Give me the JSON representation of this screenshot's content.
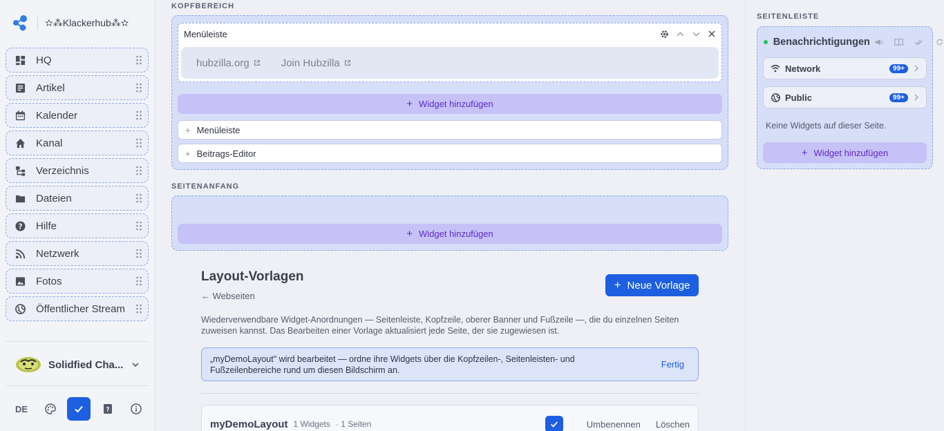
{
  "brand": {
    "name": "✫⁂Klackerhub⁂✫"
  },
  "nav": {
    "items": [
      {
        "label": "HQ",
        "icon": "hq-icon"
      },
      {
        "label": "Artikel",
        "icon": "article-icon"
      },
      {
        "label": "Kalender",
        "icon": "calendar-icon"
      },
      {
        "label": "Kanal",
        "icon": "home-icon"
      },
      {
        "label": "Verzeichnis",
        "icon": "directory-icon"
      },
      {
        "label": "Dateien",
        "icon": "folder-icon"
      },
      {
        "label": "Hilfe",
        "icon": "help-icon"
      },
      {
        "label": "Netzwerk",
        "icon": "rss-icon"
      },
      {
        "label": "Fotos",
        "icon": "photo-icon"
      },
      {
        "label": "Öffentlicher Stream",
        "icon": "globe-icon"
      }
    ]
  },
  "user": {
    "name": "Solidfied Cha..."
  },
  "bottom_bar": {
    "lang": "DE"
  },
  "sections": {
    "header": "KOPFBEREICH",
    "top": "SEITENANFANG",
    "sidebar": "SEITENLEISTE"
  },
  "header_zone": {
    "widget_title": "Menüleiste",
    "links": [
      "hubzilla.org",
      "Join Hubzilla"
    ],
    "add_label": "Widget hinzufügen",
    "available": [
      "Menüleiste",
      "Beitrags-Editor"
    ]
  },
  "top_zone": {
    "add_label": "Widget hinzufügen"
  },
  "templates": {
    "title": "Layout-Vorlagen",
    "back_label": "Webseiten",
    "new_label": "Neue Vorlage",
    "description": "Wiederverwendbare Widget-Anordnungen — Seitenleiste, Kopfzeile, oberer Banner und Fußzeile —, die du einzelnen Seiten zuweisen kannst. Das Bearbeiten einer Vorlage aktualisiert jede Seite, der sie zugewiesen ist.",
    "editing_msg": "„myDemoLayout\" wird bearbeitet — ordne ihre Widgets über die Kopfzeilen-, Seitenleisten- und Fußzeilenbereiche rund um diesen Bildschirm an.",
    "done_label": "Fertig",
    "item": {
      "name": "myDemoLayout",
      "widgets": "1 Widgets",
      "pages": "· 1 Seiten",
      "rename": "Umbenennen",
      "delete": "Löschen"
    }
  },
  "right_panel": {
    "notif_title": "Benachrichtigungen",
    "rows": [
      {
        "label": "Network",
        "badge": "99+"
      },
      {
        "label": "Public",
        "badge": "99+"
      }
    ],
    "no_widgets": "Keine Widgets auf dieser Seite.",
    "add_label": "Widget hinzufügen"
  },
  "colors": {
    "accent": "#1d5fe0",
    "zone": "#d6def8",
    "add": "#c6c2f7",
    "add_text": "#5f27c9"
  }
}
